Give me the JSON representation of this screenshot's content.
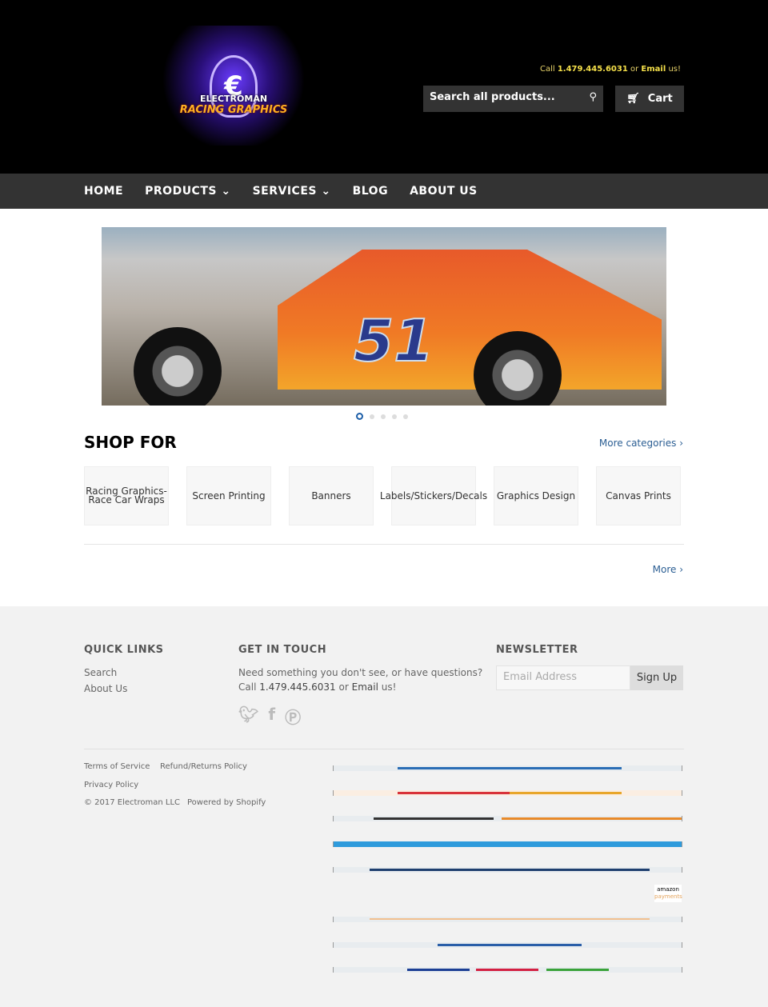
{
  "header": {
    "logo_text": [
      "ELECTROMAN",
      "RACING GRAPHICS"
    ],
    "call_prefix": "Call",
    "phone": "1.479.445.6031",
    "or": "or",
    "email": "Email",
    "us": "us!",
    "search_placeholder": "Search all products...",
    "cart": "Cart"
  },
  "nav": [
    {
      "label": "HOME"
    },
    {
      "label": "PRODUCTS ⌄"
    },
    {
      "label": "SERVICES ⌄"
    },
    {
      "label": "BLOG"
    },
    {
      "label": "ABOUT US"
    }
  ],
  "slideshow": {
    "car_number": "51",
    "slides": 5,
    "active": 1
  },
  "shop": {
    "title": "SHOP FOR",
    "more_categories": "More categories ›",
    "categories": [
      "Racing Graphics-\nRace Car Wraps",
      "Screen Printing",
      "Banners",
      "Labels/Stickers/Decals",
      "Graphics Design",
      "Canvas Prints"
    ],
    "more": "More ›"
  },
  "footer": {
    "quick_links_title": "QUICK LINKS",
    "quick_links": [
      "Search",
      "About Us"
    ],
    "touch_title": "GET IN TOUCH",
    "touch_text": "Need something you don't see, or have questions?",
    "touch_call": "Call",
    "phone": "1.479.445.6031",
    "or": "or",
    "email": "Email",
    "us": "us!",
    "newsletter_title": "NEWSLETTER",
    "email_placeholder": "Email Address",
    "signup": "Sign Up",
    "legal": [
      "Terms of Service",
      "Refund/Returns Policy",
      "Privacy Policy"
    ],
    "copyright": "© 2017 Electroman LLC",
    "powered": "Powered by Shopify",
    "amazon": [
      "amazon",
      "payments"
    ]
  }
}
